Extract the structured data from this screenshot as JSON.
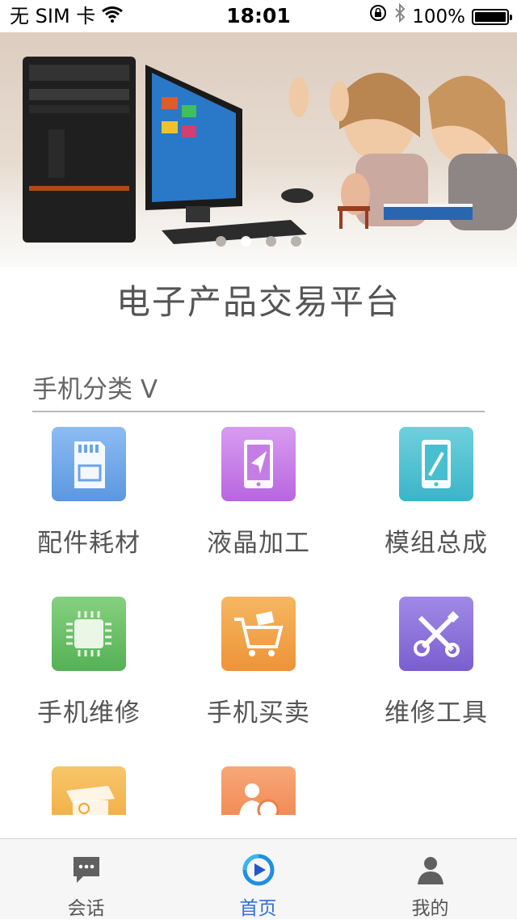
{
  "status_bar": {
    "carrier": "无 SIM 卡",
    "time": "18:01",
    "battery": "100%"
  },
  "banner": {
    "dots": 4,
    "active_dot": 1
  },
  "platform_title": "电子产品交易平台",
  "category_header": "手机分类 V",
  "categories": [
    {
      "label": "配件耗材",
      "icon": "sd-card-icon",
      "color": "#6aa5e8"
    },
    {
      "label": "液晶加工",
      "icon": "phone-send-icon",
      "color": "#c57de6"
    },
    {
      "label": "模组总成",
      "icon": "phone-screwdriver-icon",
      "color": "#47bfd0"
    },
    {
      "label": "手机维修",
      "icon": "chip-icon",
      "color": "#64bf63"
    },
    {
      "label": "手机买卖",
      "icon": "shopping-cart-icon",
      "color": "#f2a34a"
    },
    {
      "label": "维修工具",
      "icon": "wrench-screwdriver-icon",
      "color": "#8b6fd9"
    },
    {
      "label": "",
      "icon": "box-icon",
      "color": "#f2b249"
    },
    {
      "label": "",
      "icon": "person-icon",
      "color": "#f08a4f"
    }
  ],
  "tabs": [
    {
      "label": "会话",
      "icon": "chat-icon",
      "active": false
    },
    {
      "label": "首页",
      "icon": "home-logo-icon",
      "active": true
    },
    {
      "label": "我的",
      "icon": "user-icon",
      "active": false
    }
  ],
  "colors": {
    "accent": "#2f6fd8",
    "text": "#555555"
  }
}
